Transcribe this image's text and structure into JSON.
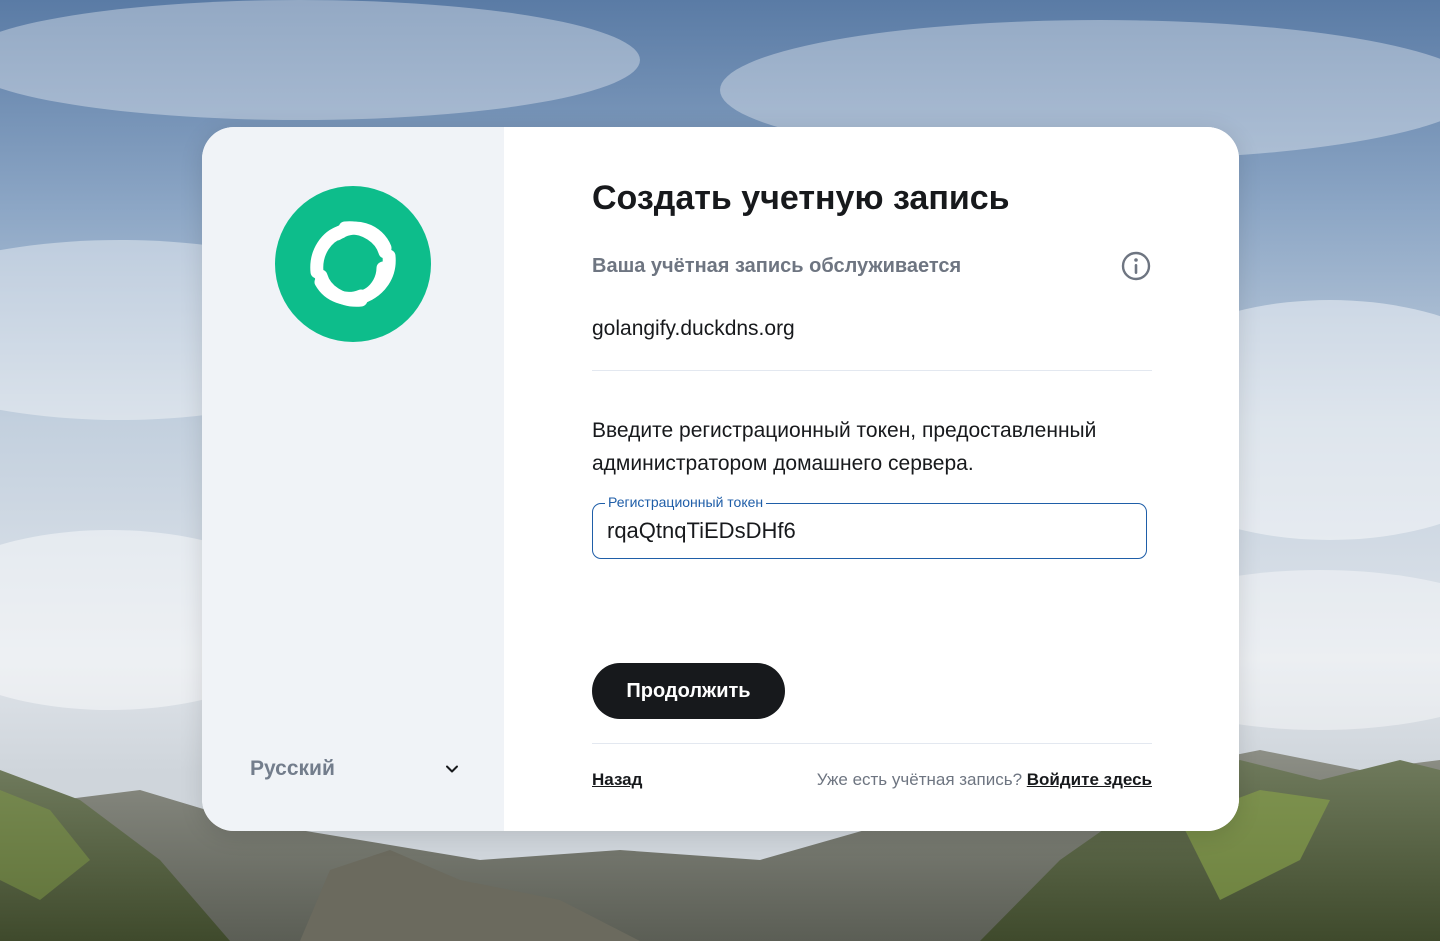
{
  "colors": {
    "brand_green": "#0dbd8b",
    "primary_text": "#17191c",
    "secondary_text": "#6e7581",
    "field_accent": "#1f5ea8",
    "button_bg": "#17191c",
    "button_text": "#ffffff"
  },
  "background": {
    "description_icon": "mountain-sky-background"
  },
  "logo": {
    "icon": "element-logo-icon"
  },
  "language": {
    "selected": "Русский",
    "icon": "chevron-down-icon"
  },
  "form": {
    "title": "Создать учетную запись",
    "server_label": "Ваша учётная запись обслуживается",
    "info_icon": "info-icon",
    "server_name": "golangify.duckdns.org",
    "instructions": "Введите регистрационный токен, предоставленный администратором домашнего сервера.",
    "token_field": {
      "label": "Регистрационный токен",
      "value": "rqaQtnqTiEDsDHf6"
    },
    "continue_label": "Продолжить"
  },
  "footer": {
    "back_label": "Назад",
    "signin_prompt": "Уже есть учётная запись?",
    "signin_link": "Войдите здесь"
  }
}
